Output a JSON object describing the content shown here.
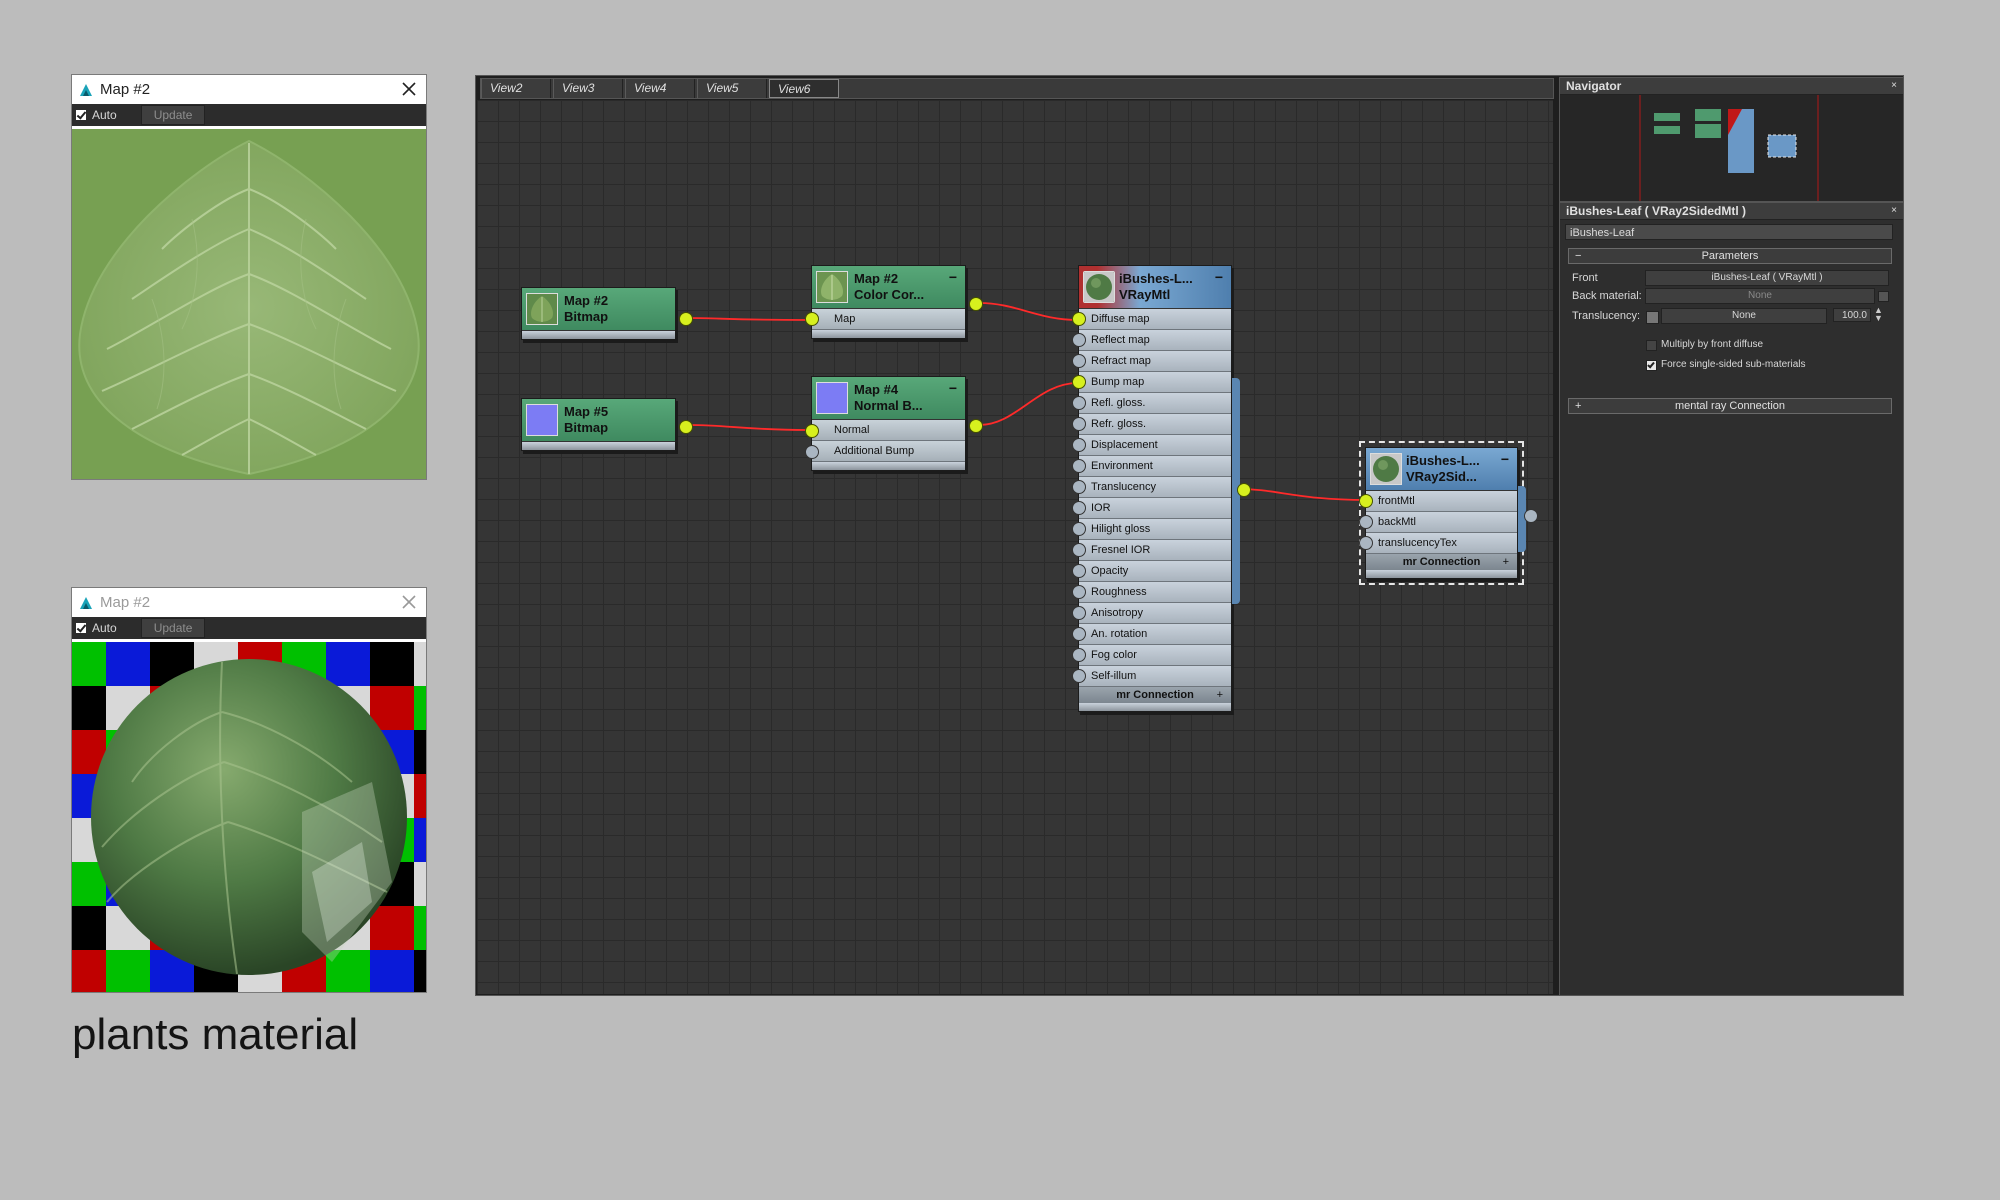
{
  "preview_top": {
    "title": "Map #2",
    "auto_label": "Auto",
    "update_label": "Update"
  },
  "preview_bottom": {
    "title": "Map #2",
    "auto_label": "Auto",
    "update_label": "Update"
  },
  "caption": "plants material",
  "tabs": [
    "View2",
    "View3",
    "View4",
    "View5",
    "View6"
  ],
  "active_tab": "View6",
  "nodes": {
    "bitmap2": {
      "title1": "Map #2",
      "title2": "Bitmap"
    },
    "bitmap5": {
      "title1": "Map #5",
      "title2": "Bitmap"
    },
    "colorcor": {
      "title1": "Map #2",
      "title2": "Color Cor...",
      "slot": "Map"
    },
    "normalbump": {
      "title1": "Map #4",
      "title2": "Normal B...",
      "slots": [
        "Normal",
        "Additional Bump"
      ]
    },
    "vraymtl": {
      "title1": "iBushes-L...",
      "title2": "VRayMtl",
      "slots": [
        "Diffuse map",
        "Reflect map",
        "Refract map",
        "Bump map",
        "Refl. gloss.",
        "Refr. gloss.",
        "Displacement",
        "Environment",
        "Translucency",
        "IOR",
        "Hilight gloss",
        "Fresnel IOR",
        "Opacity",
        "Roughness",
        "Anisotropy",
        "An. rotation",
        "Fog color",
        "Self-illum"
      ],
      "connected_slots": [
        "Diffuse map",
        "Bump map"
      ],
      "footer": "mr Connection"
    },
    "vray2sided": {
      "title1": "iBushes-L...",
      "title2": "VRay2Sid...",
      "slots": [
        "frontMtl",
        "backMtl",
        "translucencyTex"
      ],
      "footer": "mr Connection"
    }
  },
  "navigator": {
    "title": "Navigator"
  },
  "params": {
    "title": "iBushes-Leaf  ( VRay2SidedMtl )",
    "name": "iBushes-Leaf",
    "rollout_params": "Parameters",
    "front_label": "Front",
    "front_value": "iBushes-Leaf  ( VRayMtl )",
    "back_label": "Back material:",
    "back_value": "None",
    "transl_label": "Translucency:",
    "transl_value": "None",
    "transl_amount": "100.0",
    "multiply_label": "Multiply by front diffuse",
    "force_label": "Force single-sided sub-materials",
    "mr_rollout": "mental ray Connection"
  },
  "colors": {
    "wire": "#ff2a2a",
    "port_active": "#d7f01e",
    "map_node": "#4f9a6e",
    "material_node": "#6a98c6",
    "leaf_green": "#7ea35a"
  }
}
